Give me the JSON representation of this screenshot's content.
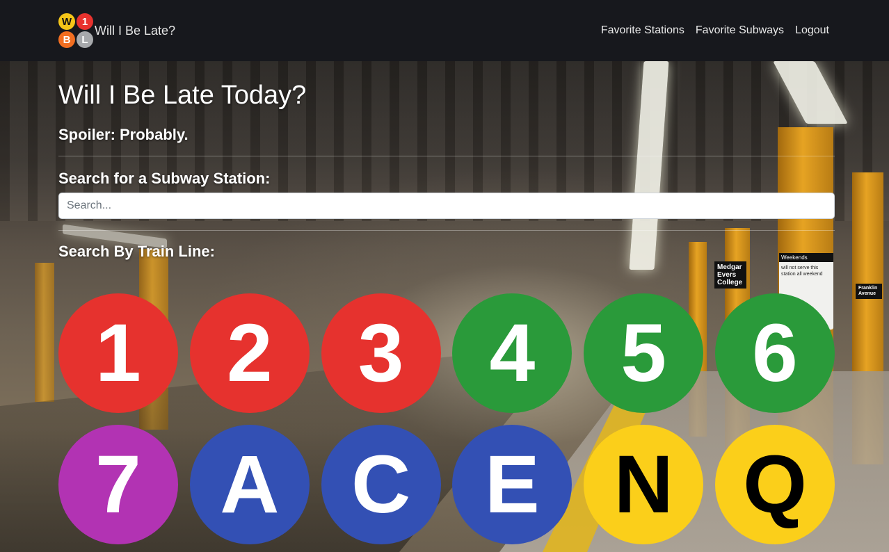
{
  "navbar": {
    "brand_title": "Will I Be Late?",
    "logo": [
      {
        "letter": "W",
        "bg": "#f5c518",
        "fg": "#111111"
      },
      {
        "letter": "1",
        "bg": "#e8322e",
        "fg": "#ffffff"
      },
      {
        "letter": "B",
        "bg": "#f26e21",
        "fg": "#ffffff"
      },
      {
        "letter": "L",
        "bg": "#a7a9ac",
        "fg": "#ffffff"
      }
    ],
    "links": [
      "Favorite Stations",
      "Favorite Subways",
      "Logout"
    ]
  },
  "main": {
    "title": "Will I Be Late Today?",
    "spoiler": "Spoiler: Probably.",
    "search_label": "Search for a Subway Station:",
    "search_placeholder": "Search...",
    "search_value": "",
    "lines_label": "Search By Train Line:"
  },
  "train_lines": [
    {
      "label": "1",
      "bg": "#e6322e",
      "fg": "#ffffff"
    },
    {
      "label": "2",
      "bg": "#e6322e",
      "fg": "#ffffff"
    },
    {
      "label": "3",
      "bg": "#e6322e",
      "fg": "#ffffff"
    },
    {
      "label": "4",
      "bg": "#2a9a3a",
      "fg": "#ffffff"
    },
    {
      "label": "5",
      "bg": "#2a9a3a",
      "fg": "#ffffff"
    },
    {
      "label": "6",
      "bg": "#2a9a3a",
      "fg": "#ffffff"
    },
    {
      "label": "7",
      "bg": "#b233b3",
      "fg": "#ffffff"
    },
    {
      "label": "A",
      "bg": "#3350b4",
      "fg": "#ffffff"
    },
    {
      "label": "C",
      "bg": "#3350b4",
      "fg": "#ffffff"
    },
    {
      "label": "E",
      "bg": "#3350b4",
      "fg": "#ffffff"
    },
    {
      "label": "N",
      "bg": "#fbcf1a",
      "fg": "#000000"
    },
    {
      "label": "Q",
      "bg": "#fbcf1a",
      "fg": "#000000"
    }
  ],
  "background_signs": {
    "station_sign": "Medgar Evers College",
    "notice_title": "Weekends",
    "notice_text": "will not serve this station all weekend",
    "side_sign": "Franklin Avenue"
  }
}
